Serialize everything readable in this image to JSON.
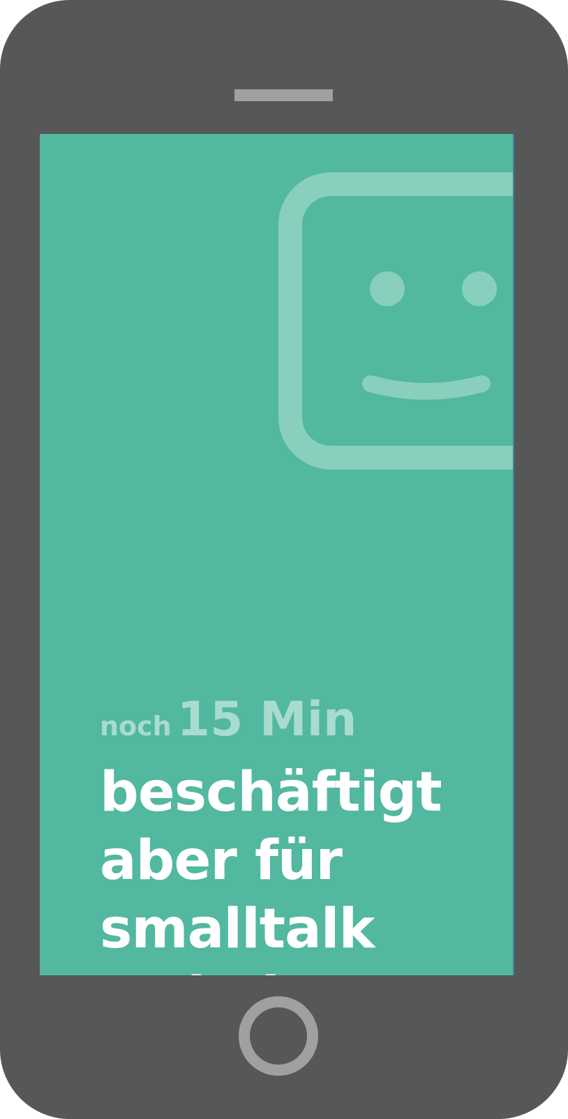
{
  "status": {
    "prefix": "noch",
    "time": "15 Min"
  },
  "headline": {
    "lines": [
      "beschäftigt",
      "aber für",
      "smalltalk",
      "zu haben"
    ]
  },
  "icons": {
    "status_face": "smiley-face-icon",
    "home": "home-button"
  },
  "colors": {
    "device_body": "#575757",
    "screen_background": "#52b8a0",
    "face_icon": "#88cfbd",
    "status_text": "#a8dccf",
    "headline_text": "#ffffff",
    "controls": "#a0a0a0"
  }
}
